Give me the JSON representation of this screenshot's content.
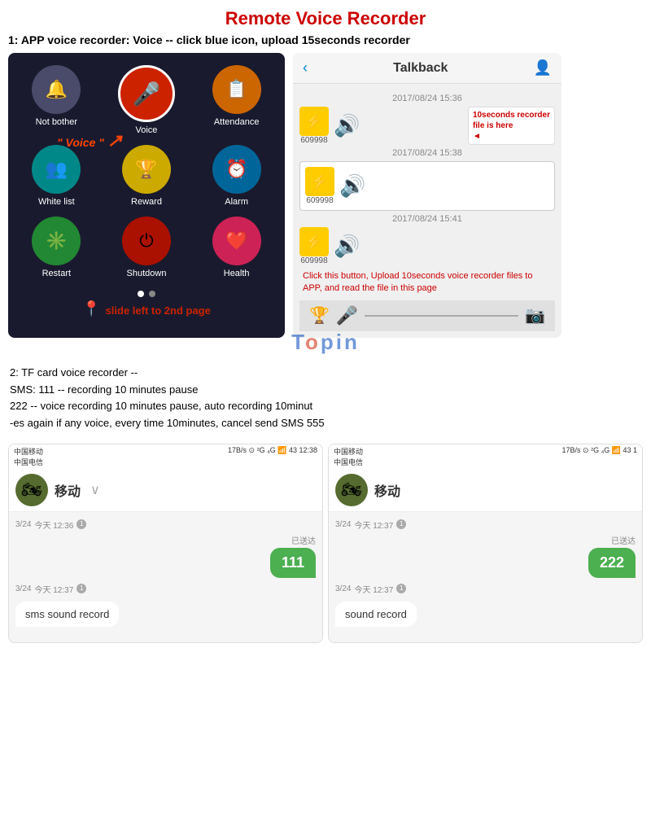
{
  "page": {
    "title": "Remote Voice Recorder",
    "step1": "1: APP voice recorder: Voice -- click blue icon, upload 15seconds recorder",
    "step2_lines": [
      "2: TF card voice recorder --",
      "   SMS: 111 -- recording 10 minutes pause",
      "        222 -- voice recording 10 minutes pause, auto recording 10minut",
      "-es again if any voice, every time 10minutes, cancel send SMS 555"
    ]
  },
  "app_icons": [
    {
      "label": "Not bother",
      "icon": "🔔",
      "color": "gray"
    },
    {
      "label": "Voice",
      "icon": "🎤",
      "color": "red",
      "center": true
    },
    {
      "label": "Attendance",
      "icon": "📋",
      "color": "orange"
    },
    {
      "label": "White list",
      "icon": "👥",
      "color": "teal"
    },
    {
      "label": "Reward",
      "icon": "🏆",
      "color": "yellow"
    },
    {
      "label": "Alarm",
      "icon": "⏰",
      "color": "blue-dark"
    },
    {
      "label": "Restart",
      "icon": "✳",
      "color": "green"
    },
    {
      "label": "Shutdown",
      "icon": "⏻",
      "color": "red-dark"
    },
    {
      "label": "Health",
      "icon": "❤",
      "color": "pink"
    }
  ],
  "voice_arrow_label": "\" Voice \"",
  "slide_text": "slide left to 2nd page",
  "talkback": {
    "title": "Talkback",
    "dates": [
      "2017/08/24 15:36",
      "2017/08/24 15:38",
      "2017/08/24 15:41"
    ],
    "chat_id": "609998",
    "annotation": "10seconds recorder\nfile is here",
    "upload_note": "Click this button, Upload 10seconds voice recorder files to APP, and read the file in this page"
  },
  "sms": [
    {
      "carrier": "中国移动\n中国电信",
      "status_right": "17B/s ⊙ 2G 4G 43 12:38",
      "contact": "移动",
      "date_label": "3/24  今天 12:36",
      "sent_label": "已送达",
      "sent_message": "111",
      "received_date": "3/24  今天 12:37",
      "received_message": "sms sound record"
    },
    {
      "carrier": "中国移动\n中国电信",
      "status_right": "17B/s ⊙ 2G 4G 43 1",
      "contact": "移动",
      "date_label": "3/24  今天 12:37",
      "sent_label": "已送达",
      "sent_message": "222",
      "received_date": "3/24  今天 12:37",
      "received_message": "sound record"
    }
  ]
}
